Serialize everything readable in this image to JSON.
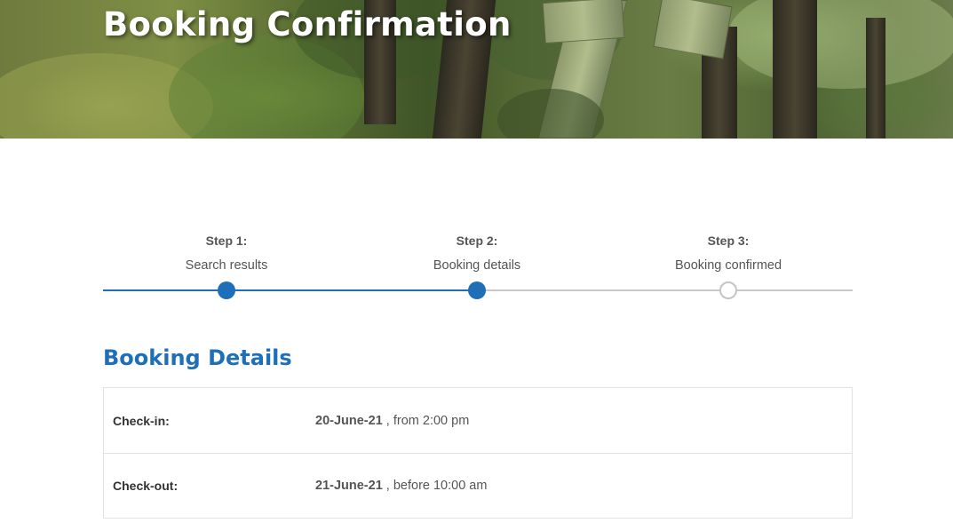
{
  "hero": {
    "title": "Booking Confirmation"
  },
  "progress": {
    "steps": [
      {
        "title": "Step 1:",
        "label": "Search results",
        "state": "complete"
      },
      {
        "title": "Step 2:",
        "label": "Booking details",
        "state": "complete"
      },
      {
        "title": "Step 3:",
        "label": "Booking confirmed",
        "state": "pending"
      }
    ]
  },
  "booking_details": {
    "heading": "Booking Details",
    "rows": [
      {
        "label": "Check-in:",
        "date": "20-June-21",
        "time_text": ", from 2:00 pm"
      },
      {
        "label": "Check-out:",
        "date": "21-June-21",
        "time_text": ", before 10:00 am"
      }
    ]
  },
  "colors": {
    "accent": "#1e6fb8",
    "track_pending": "#c8c8c8",
    "text": "#555555"
  }
}
